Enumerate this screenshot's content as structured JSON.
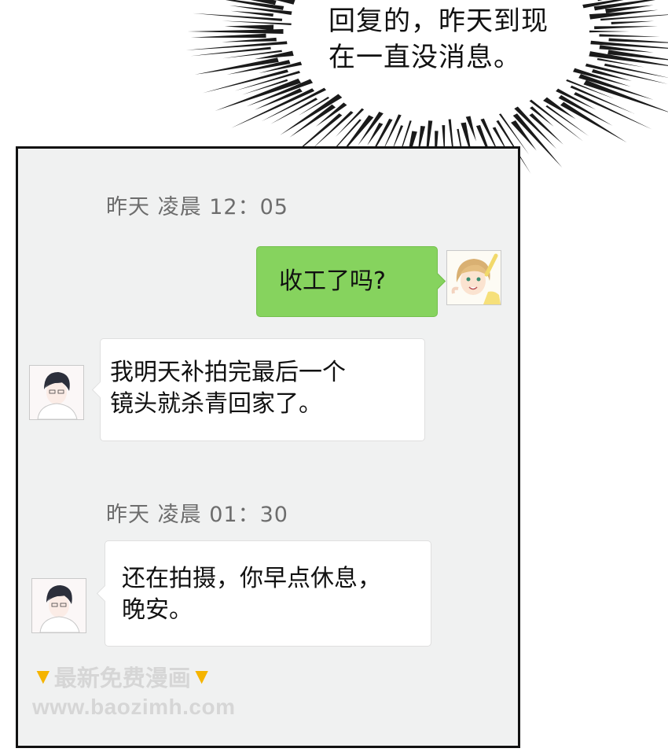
{
  "narration": {
    "line1": "回复的，昨天到现",
    "line2": "在一直没消息。"
  },
  "chat": {
    "timestamp_1": "昨天 凌晨 12：05",
    "timestamp_2": "昨天 凌晨 01：30",
    "messages": [
      {
        "side": "right",
        "lines": [
          "收工了吗?"
        ]
      },
      {
        "side": "left",
        "lines": [
          "我明天补拍完最后一个",
          "镜头就杀青回家了。"
        ]
      },
      {
        "side": "left",
        "lines": [
          "还在拍摄，你早点休息，",
          "晚安。"
        ]
      }
    ]
  },
  "watermark": {
    "title": "最新免费漫画",
    "url": "www.baozimh.com",
    "hand_icon": "pointing-down-hand-icon"
  },
  "colors": {
    "sent_bubble": "#86d35e",
    "received_bubble": "#ffffff",
    "chat_background": "#f0f1f1",
    "timestamp_text": "#6d6d6d"
  }
}
